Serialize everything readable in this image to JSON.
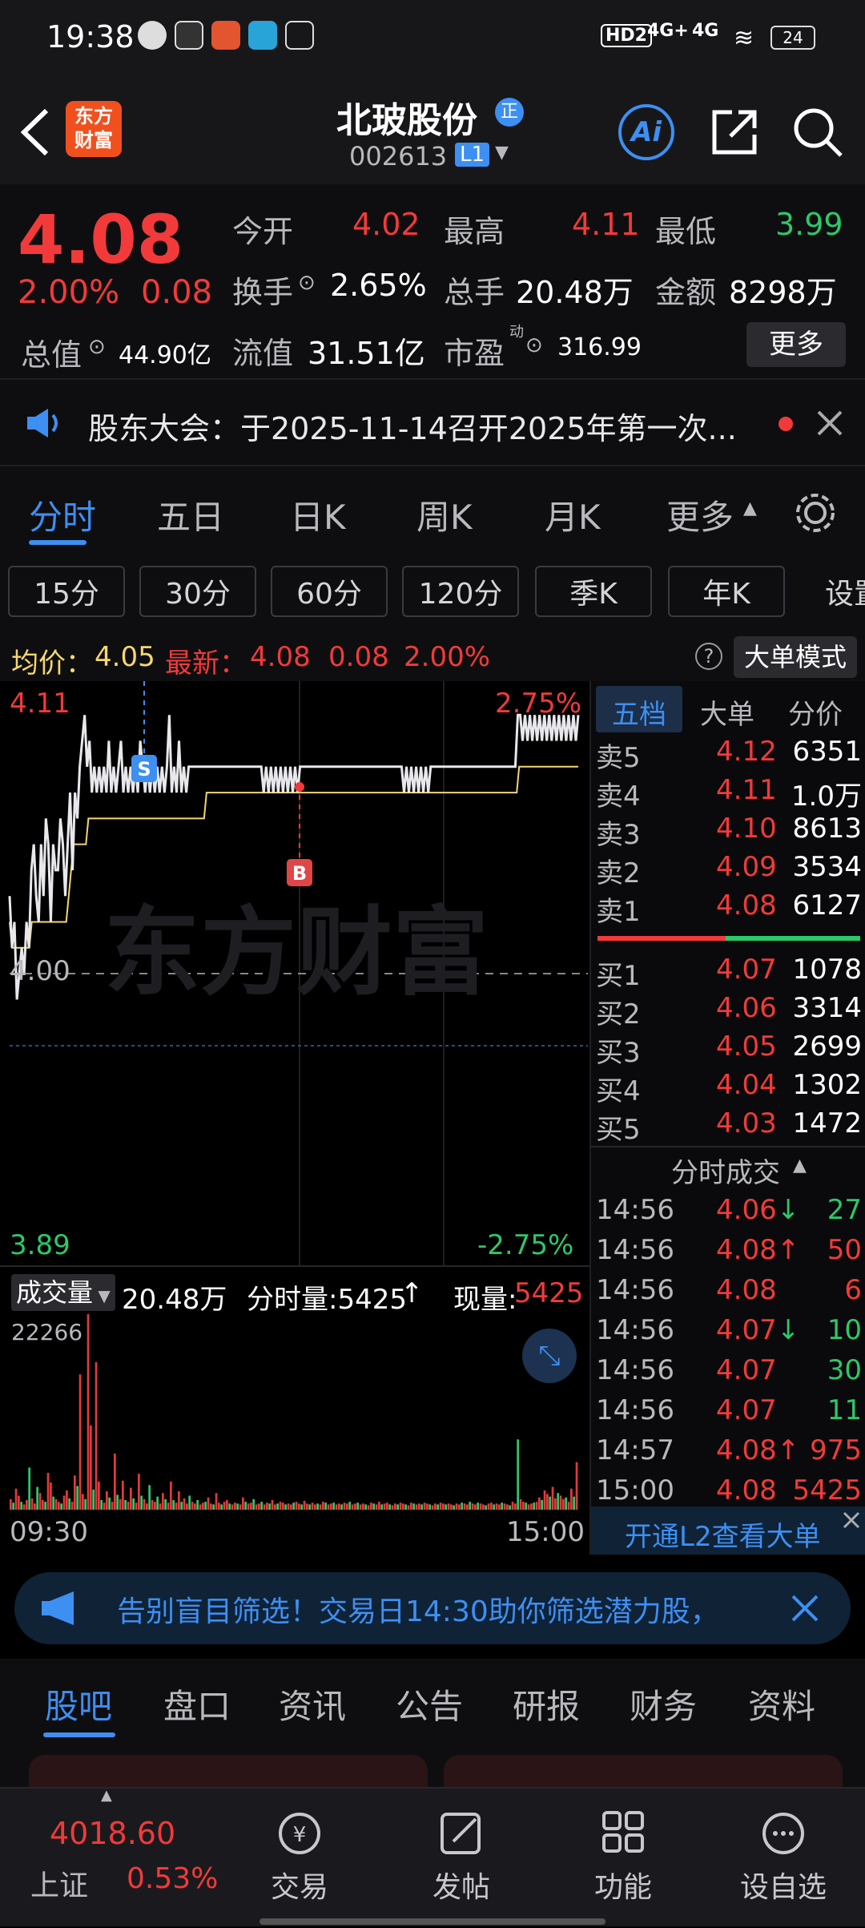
{
  "status_bar": {
    "time": "19:38",
    "network": [
      "HD2",
      "4G+",
      "4G"
    ],
    "battery": "24"
  },
  "header": {
    "logo_text_1": "东方",
    "logo_text_2": "财富",
    "stock_name": "北玻股份",
    "stock_badge": "正",
    "stock_code": "002613",
    "level_badge": "L1",
    "ai_label": "Ai"
  },
  "quote": {
    "price": "4.08",
    "change_pct": "2.00%",
    "change": "0.08",
    "open_label": "今开",
    "open": "4.02",
    "high_label": "最高",
    "high": "4.11",
    "low_label": "最低",
    "low": "3.99",
    "turnover_label": "换手",
    "turnover": "2.65%",
    "volume_label": "总手",
    "volume": "20.48万",
    "amount_label": "金额",
    "amount": "8298万",
    "mktcap_label": "总值",
    "mktcap": "44.90亿",
    "float_label": "流值",
    "float": "31.51亿",
    "pe_label": "市盈",
    "pe_sup": "动",
    "pe": "316.99",
    "more_btn": "更多"
  },
  "notice": {
    "text": "股东大会：于2025-11-14召开2025年第一次..."
  },
  "period_tabs": [
    "分时",
    "五日",
    "日K",
    "周K",
    "月K",
    "更多"
  ],
  "interval_buttons": [
    "15分",
    "30分",
    "60分",
    "120分",
    "季K",
    "年K",
    "设置"
  ],
  "avg_bar": {
    "avg_label": "均价：",
    "avg": "4.05",
    "latest_label": "最新：",
    "latest": "4.08",
    "chg": "0.08",
    "pct": "2.00%",
    "mode_btn": "大单模式"
  },
  "chart_data": {
    "type": "line",
    "y_top": "4.11",
    "y_bottom": "3.89",
    "pct_top": "2.75%",
    "pct_bottom": "-2.75%",
    "baseline": "4.00",
    "watermark": "东方财富",
    "price_range": [
      3.89,
      4.11
    ],
    "series": [
      {
        "values": [
          4.03,
          4.01,
          4.02,
          3.99,
          4.0,
          4.01,
          4.0,
          4.02,
          4.01,
          4.04,
          4.05,
          4.03,
          4.02,
          4.05,
          4.03,
          4.06,
          4.05,
          4.02,
          4.05,
          4.04,
          4.04,
          4.06,
          4.05,
          4.03,
          4.05,
          4.07,
          4.04,
          4.07,
          4.06,
          4.08,
          4.09,
          4.1,
          4.08,
          4.09,
          4.07,
          4.08,
          4.07,
          4.08,
          4.07,
          4.08,
          4.07,
          4.09,
          4.07,
          4.08,
          4.07,
          4.08,
          4.09,
          4.07,
          4.08,
          4.07,
          4.08,
          4.07,
          4.08,
          4.07,
          4.09,
          4.08,
          4.07,
          4.08,
          4.07,
          4.08,
          4.07,
          4.08,
          4.07,
          4.08,
          4.07,
          4.08,
          4.1,
          4.07,
          4.08,
          4.07,
          4.09,
          4.07,
          4.08,
          4.07,
          4.08,
          4.08,
          4.08,
          4.08,
          4.08,
          4.08,
          4.08,
          4.08,
          4.08,
          4.08,
          4.08,
          4.08,
          4.08,
          4.08,
          4.08,
          4.08,
          4.08,
          4.08,
          4.08,
          4.08,
          4.08,
          4.08,
          4.08,
          4.08,
          4.08,
          4.08,
          4.08,
          4.08,
          4.08,
          4.08,
          4.08,
          4.07,
          4.08,
          4.07,
          4.08,
          4.07,
          4.08,
          4.07,
          4.08,
          4.07,
          4.08,
          4.07,
          4.08,
          4.07,
          4.08,
          4.07,
          4.08,
          4.08,
          4.08,
          4.08,
          4.08,
          4.08,
          4.08,
          4.08,
          4.08,
          4.08,
          4.08,
          4.08,
          4.08,
          4.08,
          4.08,
          4.08,
          4.08,
          4.08,
          4.08,
          4.08,
          4.08,
          4.08,
          4.08,
          4.08,
          4.08,
          4.08,
          4.08,
          4.08,
          4.08,
          4.08,
          4.08,
          4.08,
          4.08,
          4.08,
          4.08,
          4.08,
          4.08,
          4.08,
          4.08,
          4.08,
          4.08,
          4.08,
          4.08,
          4.07,
          4.08,
          4.07,
          4.08,
          4.07,
          4.08,
          4.07,
          4.08,
          4.07,
          4.08,
          4.07,
          4.08,
          4.08,
          4.08,
          4.08,
          4.08,
          4.08,
          4.08,
          4.08,
          4.08,
          4.08,
          4.08,
          4.08,
          4.08,
          4.08,
          4.08,
          4.08,
          4.08,
          4.08,
          4.08,
          4.08,
          4.08,
          4.08,
          4.08,
          4.08,
          4.08,
          4.08,
          4.08,
          4.08,
          4.08,
          4.08,
          4.08,
          4.08,
          4.08,
          4.08,
          4.08,
          4.08,
          4.1,
          4.1,
          4.09,
          4.1,
          4.09,
          4.1,
          4.09,
          4.1,
          4.09,
          4.1,
          4.09,
          4.1,
          4.09,
          4.1,
          4.09,
          4.1,
          4.09,
          4.1,
          4.09,
          4.1,
          4.09,
          4.1,
          4.09,
          4.1,
          4.09,
          4.1
        ]
      },
      {
        "values": [
          4.02,
          4.01,
          4.01,
          4.01,
          4.01,
          4.01,
          4.01,
          4.01,
          4.01,
          4.02,
          4.02,
          4.02,
          4.02,
          4.02,
          4.02,
          4.02,
          4.02,
          4.02,
          4.02,
          4.02,
          4.02,
          4.02,
          4.02,
          4.02,
          4.03,
          4.04,
          4.05,
          4.05,
          4.05,
          4.05,
          4.05,
          4.05,
          4.06,
          4.06,
          4.06,
          4.06,
          4.06,
          4.06,
          4.06,
          4.06,
          4.06,
          4.06,
          4.06,
          4.06,
          4.06,
          4.06,
          4.06,
          4.06,
          4.06,
          4.06,
          4.06,
          4.06,
          4.06,
          4.06,
          4.06,
          4.06,
          4.06,
          4.06,
          4.06,
          4.06,
          4.06,
          4.06,
          4.06,
          4.06,
          4.06,
          4.06,
          4.06,
          4.06,
          4.06,
          4.06,
          4.06,
          4.06,
          4.06,
          4.06,
          4.06,
          4.06,
          4.06,
          4.06,
          4.06,
          4.06,
          4.07,
          4.07,
          4.07,
          4.07,
          4.07,
          4.07,
          4.07,
          4.07,
          4.07,
          4.07,
          4.07,
          4.07,
          4.07,
          4.07,
          4.07,
          4.07,
          4.07,
          4.07,
          4.07,
          4.07,
          4.07,
          4.07,
          4.07,
          4.07,
          4.07,
          4.07,
          4.07,
          4.07,
          4.07,
          4.07,
          4.07,
          4.07,
          4.07,
          4.07,
          4.07,
          4.07,
          4.07,
          4.07,
          4.07,
          4.07,
          4.07,
          4.07,
          4.07,
          4.07,
          4.07,
          4.07,
          4.07,
          4.07,
          4.07,
          4.07,
          4.07,
          4.07,
          4.07,
          4.07,
          4.07,
          4.07,
          4.07,
          4.07,
          4.07,
          4.07,
          4.07,
          4.07,
          4.07,
          4.07,
          4.07,
          4.07,
          4.07,
          4.07,
          4.07,
          4.07,
          4.07,
          4.07,
          4.07,
          4.07,
          4.07,
          4.07,
          4.07,
          4.07,
          4.07,
          4.07,
          4.07,
          4.07,
          4.07,
          4.07,
          4.07,
          4.07,
          4.07,
          4.07,
          4.07,
          4.07,
          4.07,
          4.07,
          4.07,
          4.07,
          4.07,
          4.07,
          4.07,
          4.07,
          4.07,
          4.07,
          4.07,
          4.07,
          4.07,
          4.07,
          4.07,
          4.07,
          4.07,
          4.07,
          4.07,
          4.07,
          4.07,
          4.07,
          4.07,
          4.07,
          4.07,
          4.07,
          4.07,
          4.07,
          4.07,
          4.07,
          4.07,
          4.07,
          4.07,
          4.07,
          4.07,
          4.07,
          4.07,
          4.08,
          4.08,
          4.08,
          4.08,
          4.08,
          4.08,
          4.08,
          4.08,
          4.08,
          4.08,
          4.08,
          4.08,
          4.08,
          4.08,
          4.08,
          4.08,
          4.08,
          4.08,
          4.08,
          4.08,
          4.08,
          4.08,
          4.08,
          4.08,
          4.08
        ]
      }
    ],
    "markers": [
      {
        "label": "S"
      },
      {
        "label": "B"
      }
    ],
    "volume": {
      "selector": "成交量",
      "total": "20.48万",
      "tick_label": "分时量:5425",
      "tick_arrow": "↑",
      "now_label": "现量:",
      "now_val": "5425",
      "max": "22266",
      "max_value": 22266,
      "bars": [
        1200,
        800,
        2400,
        1600,
        900,
        600,
        1100,
        4800,
        1300,
        700,
        2600,
        1900,
        1100,
        900,
        4200,
        3100,
        1500,
        1200,
        900,
        700,
        1600,
        2200,
        1300,
        900,
        3900,
        2700,
        15400,
        1800,
        1200,
        22266,
        9600,
        2300,
        16800,
        3200,
        1100,
        800,
        2100,
        1400,
        900,
        6400,
        1700,
        1200,
        3300,
        1100,
        900,
        2500,
        1300,
        800,
        4100,
        1600,
        1200,
        700,
        2800,
        1100,
        900,
        1500,
        700,
        1900,
        1200,
        800,
        3200,
        1100,
        800,
        2100,
        900,
        1300,
        700,
        1600,
        900,
        700,
        1100,
        600,
        800,
        900,
        1400,
        700,
        600,
        1900,
        800,
        600,
        900,
        1100,
        700,
        600,
        800,
        700,
        600,
        1400,
        900,
        700,
        800,
        1200,
        600,
        700,
        900,
        600,
        800,
        700,
        1100,
        600,
        700,
        900,
        800,
        600,
        700,
        600,
        800,
        900,
        700,
        600,
        1000,
        700,
        600,
        800,
        600,
        700,
        600,
        900,
        800,
        600,
        700,
        800,
        600,
        700,
        600,
        800,
        700,
        900,
        600,
        700,
        800,
        600,
        700,
        600,
        500,
        800,
        700,
        600,
        900,
        600,
        700,
        800,
        600,
        500,
        700,
        600,
        800,
        700,
        600,
        500,
        800,
        700,
        600,
        700,
        600,
        800,
        700,
        600,
        500,
        700,
        600,
        800,
        700,
        600,
        700,
        600,
        500,
        700,
        600,
        800,
        700,
        600,
        900,
        700,
        600,
        800,
        700,
        600,
        500,
        700,
        800,
        600,
        700,
        600,
        800,
        700,
        600,
        500,
        900,
        700,
        8000,
        1200,
        900,
        800,
        600,
        700,
        800,
        900,
        1400,
        1100,
        2200,
        1800,
        1500,
        2600,
        1300,
        1900,
        1600,
        1200,
        1400,
        900,
        2400,
        1500,
        5425
      ],
      "time_start": "09:30",
      "time_end": "15:00"
    }
  },
  "orderbook": {
    "tabs": [
      "五档",
      "大单",
      "分价"
    ],
    "asks": [
      {
        "label": "卖5",
        "price": "4.12",
        "vol": "6351"
      },
      {
        "label": "卖4",
        "price": "4.11",
        "vol": "1.0万"
      },
      {
        "label": "卖3",
        "price": "4.10",
        "vol": "8613"
      },
      {
        "label": "卖2",
        "price": "4.09",
        "vol": "3534"
      },
      {
        "label": "卖1",
        "price": "4.08",
        "vol": "6127"
      }
    ],
    "bids": [
      {
        "label": "买1",
        "price": "4.07",
        "vol": "1078"
      },
      {
        "label": "买2",
        "price": "4.06",
        "vol": "3314"
      },
      {
        "label": "买3",
        "price": "4.05",
        "vol": "2699"
      },
      {
        "label": "买4",
        "price": "4.04",
        "vol": "1302"
      },
      {
        "label": "买5",
        "price": "4.03",
        "vol": "1472"
      }
    ],
    "ticks_title": "分时成交",
    "ticks": [
      {
        "time": "14:56",
        "price": "4.06",
        "dir": "↓",
        "vol": "27",
        "color": "#2dc86a"
      },
      {
        "time": "14:56",
        "price": "4.08",
        "dir": "↑",
        "vol": "50",
        "color": "#f23a3a"
      },
      {
        "time": "14:56",
        "price": "4.08",
        "dir": "",
        "vol": "6",
        "color": "#f23a3a"
      },
      {
        "time": "14:56",
        "price": "4.07",
        "dir": "↓",
        "vol": "10",
        "color": "#2dc86a"
      },
      {
        "time": "14:56",
        "price": "4.07",
        "dir": "",
        "vol": "30",
        "color": "#2dc86a"
      },
      {
        "time": "14:56",
        "price": "4.07",
        "dir": "",
        "vol": "11",
        "color": "#2dc86a"
      },
      {
        "time": "14:57",
        "price": "4.08",
        "dir": "↑",
        "vol": "975",
        "color": "#f23a3a"
      },
      {
        "time": "15:00",
        "price": "4.08",
        "dir": "",
        "vol": "5425",
        "color": "#f23a3a"
      }
    ],
    "l2_link": "开通L2查看大单"
  },
  "promo": {
    "text": "告别盲目筛选！交易日14:30助你筛选潜力股，"
  },
  "sub_tabs": [
    "股吧",
    "盘口",
    "资讯",
    "公告",
    "研报",
    "财务",
    "资料"
  ],
  "bottom_nav": {
    "index_value": "4018.60",
    "index_name": "上证",
    "index_pct": "0.53%",
    "items": [
      "交易",
      "发帖",
      "功能",
      "设自选"
    ]
  },
  "colors": {
    "up": "#f23a3a",
    "down": "#2dc86a",
    "accent": "#3d8ff2",
    "avg_line": "#f5d76e"
  }
}
